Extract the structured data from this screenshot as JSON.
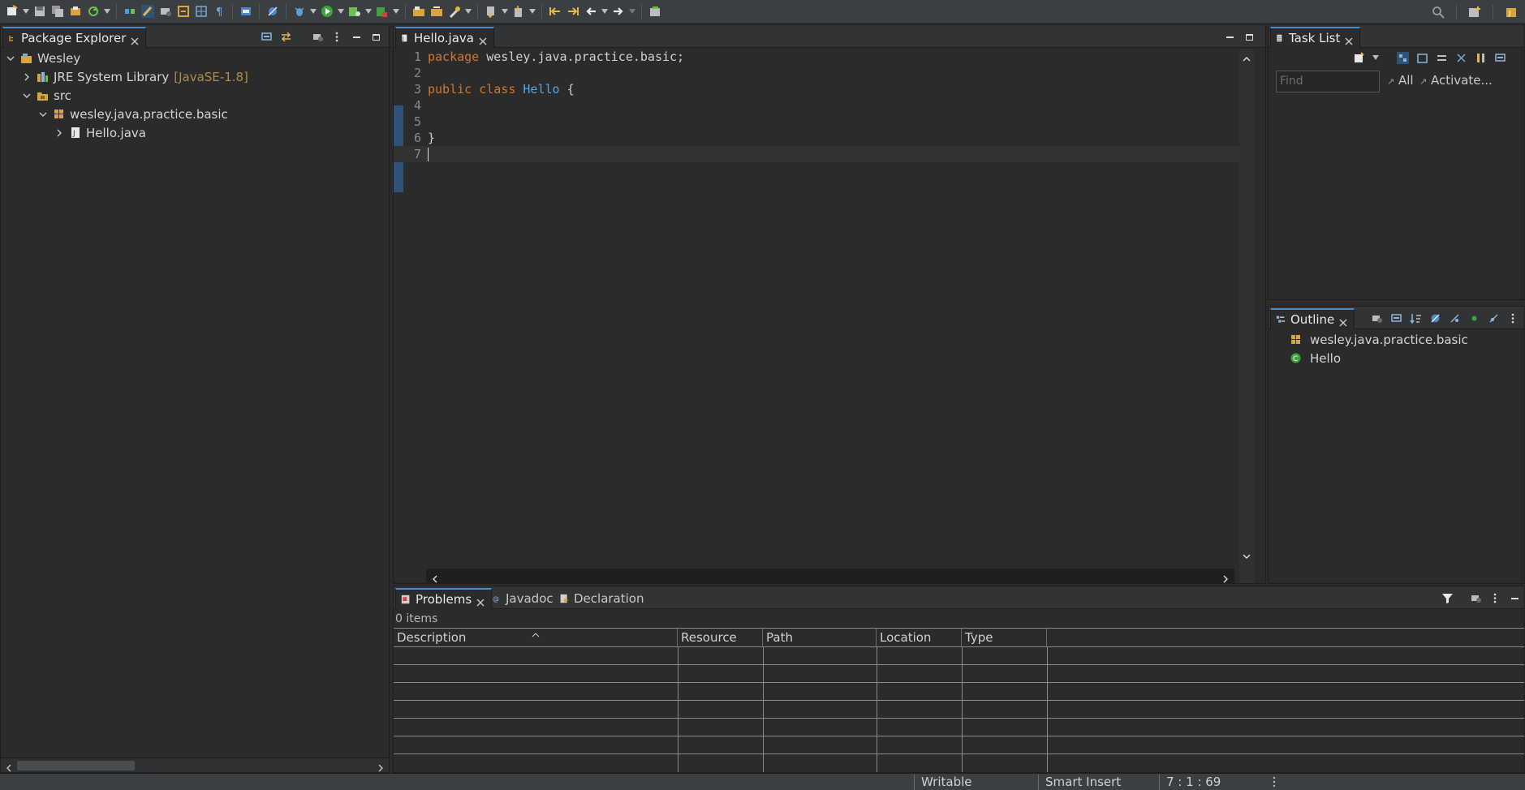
{
  "toolbar": {
    "left_icons": [
      "new-icon",
      "save-icon",
      "save-all-icon",
      "open-type-icon",
      "refresh-icon",
      "toggle-breadcrumb-icon",
      "mark-occurrences-icon",
      "open-task-icon",
      "show-whitespace-icon",
      "block-selection-icon",
      "word-wrap-icon",
      "toggle-view-icon",
      "skip-breakpoints-icon",
      "debug-icon",
      "run-icon",
      "coverage-icon",
      "external-tools-icon",
      "new-java-project-icon",
      "new-package-icon",
      "new-class-icon",
      "open-type-hierarchy-icon",
      "next-annotation-icon",
      "previous-annotation-icon",
      "last-edit-icon",
      "back-icon",
      "forward-icon",
      "pin-editor-icon"
    ],
    "right_icons": [
      "search-icon",
      "open-perspective-icon",
      "java-perspective-icon"
    ]
  },
  "package_explorer": {
    "tab_label": "Package Explorer",
    "tree": [
      {
        "label": "Wesley",
        "decor": "",
        "icon": "project-icon",
        "expanded": true
      },
      {
        "label": "JRE System Library",
        "decor": "[JavaSE-1.8]",
        "icon": "library-icon",
        "expanded": false
      },
      {
        "label": "src",
        "decor": "",
        "icon": "source-folder-icon",
        "expanded": true
      },
      {
        "label": "wesley.java.practice.basic",
        "decor": "",
        "icon": "package-icon",
        "expanded": true
      },
      {
        "label": "Hello.java",
        "decor": "",
        "icon": "java-file-icon",
        "expanded": false
      }
    ]
  },
  "editor": {
    "tab_label": "Hello.java",
    "lines": [
      {
        "n": "1",
        "parts": [
          {
            "t": "package",
            "k": "kw"
          },
          {
            "t": " wesley.java.practice.basic;",
            "k": ""
          }
        ]
      },
      {
        "n": "2",
        "parts": []
      },
      {
        "n": "3",
        "parts": [
          {
            "t": "public",
            "k": "kw"
          },
          {
            "t": " ",
            "k": ""
          },
          {
            "t": "class",
            "k": "kw"
          },
          {
            "t": " ",
            "k": ""
          },
          {
            "t": "Hello",
            "k": "cls"
          },
          {
            "t": " {",
            "k": ""
          }
        ]
      },
      {
        "n": "4",
        "parts": []
      },
      {
        "n": "5",
        "parts": []
      },
      {
        "n": "6",
        "parts": [
          {
            "t": "}",
            "k": ""
          }
        ]
      },
      {
        "n": "7",
        "parts": []
      }
    ],
    "current_line": "7"
  },
  "task_list": {
    "tab_label": "Task List",
    "find_placeholder": "Find",
    "all_label": "All",
    "activate_label": "Activate..."
  },
  "outline": {
    "tab_label": "Outline",
    "items": [
      {
        "label": "wesley.java.practice.basic",
        "icon": "package-icon"
      },
      {
        "label": "Hello",
        "icon": "class-icon"
      }
    ]
  },
  "problems": {
    "tabs": [
      {
        "label": "Problems",
        "icon": "problems-icon"
      },
      {
        "label": "Javadoc",
        "icon": "javadoc-icon"
      },
      {
        "label": "Declaration",
        "icon": "declaration-icon"
      }
    ],
    "items_count": "0 items",
    "columns": [
      "Description",
      "Resource",
      "Path",
      "Location",
      "Type"
    ]
  },
  "status": {
    "writable": "Writable",
    "insert_mode": "Smart Insert",
    "position": "7 : 1 : 69"
  },
  "colors": {
    "keyword": "#cc7832",
    "class_name": "#4fa6e6",
    "accent": "#4a88c7"
  }
}
